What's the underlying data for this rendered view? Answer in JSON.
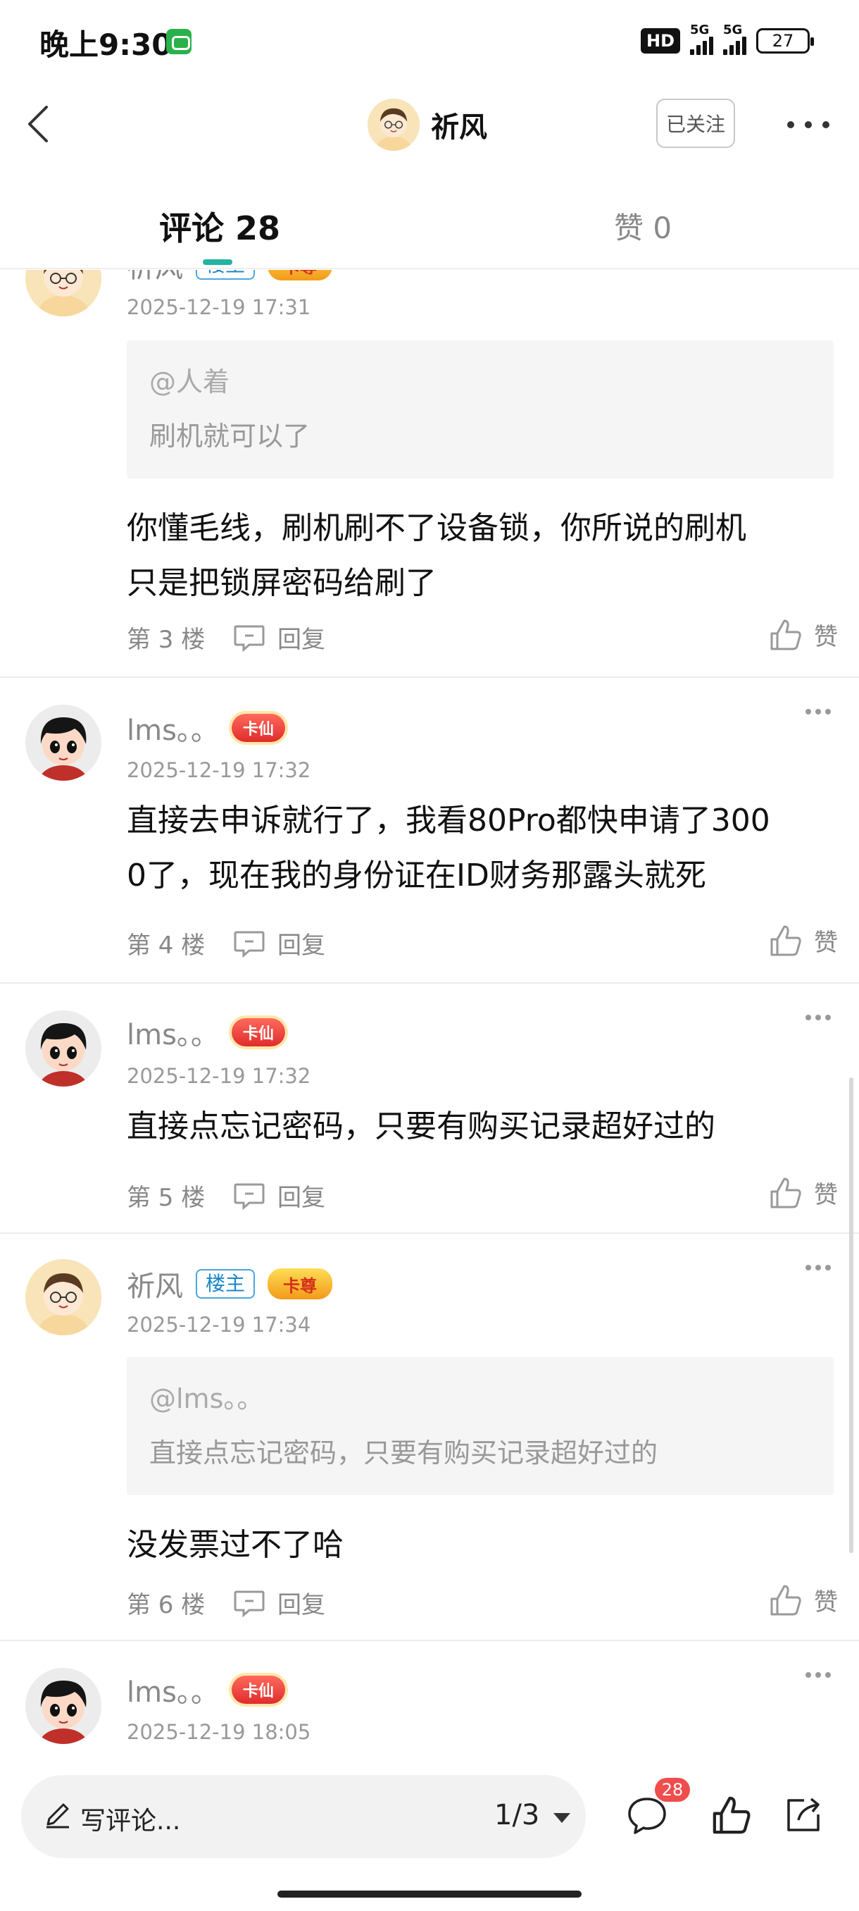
{
  "status": {
    "time": "晚上9:30",
    "hd": "HD",
    "sig1": "5G",
    "sig2": "5G",
    "battery": "27"
  },
  "nav": {
    "author": "祈风",
    "follow_label": "已关注"
  },
  "tabs": {
    "comments": "评论 28",
    "likes": "赞 0"
  },
  "reply_label": "回复",
  "like_label": "赞",
  "comments": [
    {
      "name": "祈风",
      "host_badge": "楼主",
      "level_badge": "卡尊",
      "time": "2025-12-19 17:31",
      "quote_at": "@人着",
      "quote_text": "刷机就可以了",
      "lines": [
        "你懂毛线，刷机刷不了设备锁，你所说的刷机",
        "只是把锁屏密码给刷了"
      ],
      "floor": "第 3 楼"
    },
    {
      "name": "lms。。",
      "level_badge": "卡仙",
      "time": "2025-12-19 17:32",
      "lines": [
        "直接去申诉就行了，我看80Pro都快申请了300",
        "0了，现在我的身份证在ID财务那露头就死"
      ],
      "floor": "第 4 楼"
    },
    {
      "name": "lms。。",
      "level_badge": "卡仙",
      "time": "2025-12-19 17:32",
      "lines": [
        "直接点忘记密码，只要有购买记录超好过的"
      ],
      "floor": "第 5 楼"
    },
    {
      "name": "祈风",
      "host_badge": "楼主",
      "level_badge": "卡尊",
      "time": "2025-12-19 17:34",
      "quote_at": "@lms。。",
      "quote_text": "直接点忘记密码，只要有购买记录超好过的",
      "lines": [
        "没发票过不了哈"
      ],
      "floor": "第 6 楼"
    },
    {
      "name": "lms。。",
      "level_badge": "卡仙",
      "time": "2025-12-19 18:05"
    }
  ],
  "bottom": {
    "placeholder": "写评论...",
    "page": "1/3",
    "comment_count": "28"
  },
  "colors": {
    "accent": "#22b3a2",
    "host_badge": "#1a86c9",
    "count_badge": "#f04d4d"
  }
}
